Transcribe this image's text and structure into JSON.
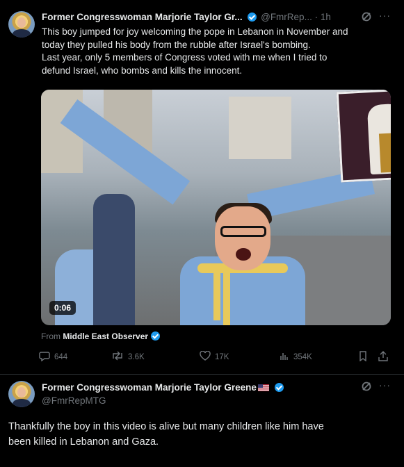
{
  "post1": {
    "author_name": "Former Congresswoman Marjorie Taylor Gr...",
    "handle": "@FmrRep...",
    "time": "1h",
    "text_lines": [
      "This boy jumped for joy welcoming the pope in Lebanon in November and",
      "today they pulled his body from the rubble after Israel's bombing.",
      "Last year, only 5 members of Congress voted with me when I tried to",
      "defund Israel, who bombs and kills the innocent."
    ],
    "video_time": "0:06",
    "source_prefix": "From",
    "source_name": "Middle East Observer",
    "stats": {
      "replies": "644",
      "reposts": "3.6K",
      "likes": "17K",
      "views": "354K"
    }
  },
  "post2": {
    "author_name": "Former Congresswoman Marjorie Taylor Greene",
    "handle": "@FmrRepMTG",
    "text_lines": [
      "Thankfully the boy in this video is alive but many children like him have",
      "been killed in Lebanon and Gaza."
    ]
  },
  "icons": {
    "more": "more-icon",
    "grok": "grok-icon",
    "reply": "reply-icon",
    "repost": "repost-icon",
    "like": "like-icon",
    "views": "views-icon",
    "bookmark": "bookmark-icon",
    "share": "share-icon",
    "verified": "verified-badge-icon"
  },
  "colors": {
    "background": "#000000",
    "text": "#e7e9ea",
    "muted": "#71767b",
    "verified_blue": "#1d9bf0"
  }
}
